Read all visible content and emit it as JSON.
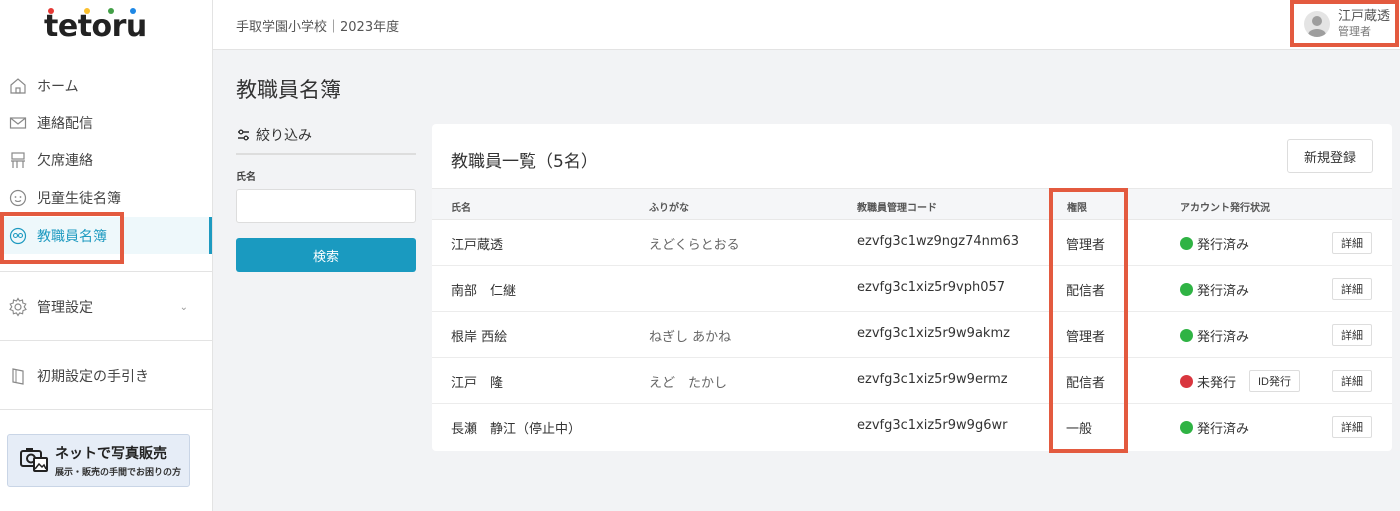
{
  "app": {
    "logo_text": "tetoru"
  },
  "header": {
    "school": "手取学園小学校｜2023年度",
    "user_name": "江戸蔵透",
    "user_role": "管理者"
  },
  "sidebar": {
    "items": [
      {
        "label": "ホーム",
        "icon": "home-icon"
      },
      {
        "label": "連絡配信",
        "icon": "mail-icon"
      },
      {
        "label": "欠席連絡",
        "icon": "desk-icon"
      },
      {
        "label": "児童生徒名簿",
        "icon": "student-icon"
      },
      {
        "label": "教職員名簿",
        "icon": "staff-icon",
        "active": true
      },
      {
        "label": "管理設定",
        "icon": "gear-icon"
      },
      {
        "label": "初期設定の手引き",
        "icon": "book-icon"
      }
    ],
    "promo": {
      "title": "ネットで写真販売",
      "subtitle": "展示・販売の手間でお困りの方"
    }
  },
  "page": {
    "title": "教職員名簿"
  },
  "filter": {
    "title": "絞り込み",
    "name_label": "氏名",
    "name_value": "",
    "search_label": "検索"
  },
  "list": {
    "title": "教職員一覧（5名）",
    "new_label": "新規登録",
    "columns": [
      "氏名",
      "ふりがな",
      "教職員管理コード",
      "権限",
      "アカウント発行状況"
    ],
    "rows": [
      {
        "name": "江戸蔵透",
        "kana": "えどくらとおる",
        "code": "ezvfg3c1wz9ngz74nm63",
        "role": "管理者",
        "status": "発行済み",
        "issued": true,
        "detail": "詳細"
      },
      {
        "name": "南部　仁継",
        "kana": "",
        "code": "ezvfg3c1xiz5r9vph057",
        "role": "配信者",
        "status": "発行済み",
        "issued": true,
        "detail": "詳細"
      },
      {
        "name": "根岸 西絵",
        "kana": "ねぎし あかね",
        "code": "ezvfg3c1xiz5r9w9akmz",
        "role": "管理者",
        "status": "発行済み",
        "issued": true,
        "detail": "詳細"
      },
      {
        "name": "江戸　隆",
        "kana": "えど　たかし",
        "code": "ezvfg3c1xiz5r9w9ermz",
        "role": "配信者",
        "status": "未発行",
        "issued": false,
        "id_btn": "ID発行",
        "detail": "詳細"
      },
      {
        "name": "長瀬　静江（停止中）",
        "kana": "",
        "code": "ezvfg3c1xiz5r9w9g6wr",
        "role": "一般",
        "status": "発行済み",
        "issued": true,
        "detail": "詳細"
      }
    ]
  },
  "colors": {
    "accent": "#1a9ac0",
    "issued": "#2fb344",
    "not_issued": "#d9363e",
    "highlight": "#e35a3f"
  }
}
